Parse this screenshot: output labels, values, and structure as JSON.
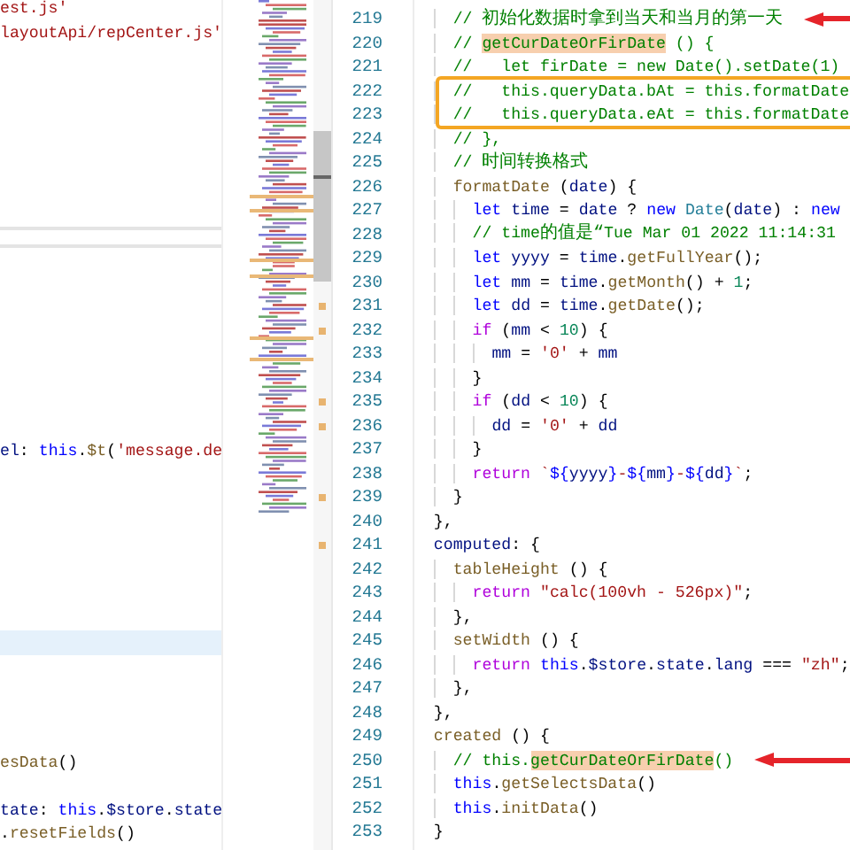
{
  "left_editor": {
    "top_lines": [
      {
        "text": "est.js'"
      },
      {
        "text": "layoutApi/repCenter.js'"
      }
    ],
    "bottom_lines": [
      {
        "text": "el: this.$t('message.de"
      },
      {
        "text": "esData()"
      },
      {
        "text": "tate: this.$store.state"
      },
      {
        "text": ".resetFields()"
      }
    ]
  },
  "editor": {
    "lines": [
      {
        "number": "219",
        "text": "    // 初始化数据时拿到当天和当月的第一天",
        "arrow": true,
        "boxed": false,
        "modified": false
      },
      {
        "number": "220",
        "segments": [
          {
            "text": "    // ",
            "highlighted": false
          },
          {
            "text": "getCurDateOrFirDate",
            "highlighted": true
          },
          {
            "text": " () {",
            "highlighted": false
          }
        ],
        "arrow": false,
        "boxed": false,
        "modified": false
      },
      {
        "number": "221",
        "text": "    //   let firDate = new Date().setDate(1)",
        "arrow": false,
        "boxed": false,
        "modified": false
      },
      {
        "number": "222",
        "text": "    //   this.queryData.bAt = this.formatDate",
        "arrow": false,
        "boxed": true,
        "modified": false
      },
      {
        "number": "223",
        "text": "    //   this.queryData.eAt = this.formatDate",
        "arrow": false,
        "boxed": true,
        "modified": false
      },
      {
        "number": "224",
        "text": "    // },",
        "arrow": false,
        "boxed": false,
        "modified": false
      },
      {
        "number": "225",
        "text": "    // 时间转换格式",
        "arrow": false,
        "boxed": false,
        "modified": false
      },
      {
        "number": "226",
        "text": "    formatDate (date) {",
        "arrow": false,
        "boxed": false,
        "modified": false
      },
      {
        "number": "227",
        "text": "      let time = date ? new Date(date) : new",
        "arrow": false,
        "boxed": false,
        "modified": false
      },
      {
        "number": "228",
        "text": "      // time的值是“Tue Mar 01 2022 11:14:31",
        "arrow": false,
        "boxed": false,
        "modified": false
      },
      {
        "number": "229",
        "text": "      let yyyy = time.getFullYear();",
        "arrow": false,
        "boxed": false,
        "modified": false
      },
      {
        "number": "230",
        "text": "      let mm = time.getMonth() + 1;",
        "arrow": false,
        "boxed": false,
        "modified": false
      },
      {
        "number": "231",
        "text": "      let dd = time.getDate();",
        "arrow": false,
        "boxed": false,
        "modified": true
      },
      {
        "number": "232",
        "text": "      if (mm < 10) {",
        "arrow": false,
        "boxed": false,
        "modified": true
      },
      {
        "number": "233",
        "text": "        mm = '0' + mm",
        "arrow": false,
        "boxed": false,
        "modified": false
      },
      {
        "number": "234",
        "text": "      }",
        "arrow": false,
        "boxed": false,
        "modified": false
      },
      {
        "number": "235",
        "text": "      if (dd < 10) {",
        "arrow": false,
        "boxed": false,
        "modified": true
      },
      {
        "number": "236",
        "text": "        dd = '0' + dd",
        "arrow": false,
        "boxed": false,
        "modified": true
      },
      {
        "number": "237",
        "text": "      }",
        "arrow": false,
        "boxed": false,
        "modified": false
      },
      {
        "number": "238",
        "text": "      return `${yyyy}-${mm}-${dd}`;",
        "arrow": false,
        "boxed": false,
        "modified": false
      },
      {
        "number": "239",
        "text": "    }",
        "arrow": false,
        "boxed": false,
        "modified": true
      },
      {
        "number": "240",
        "text": "  },",
        "arrow": false,
        "boxed": false,
        "modified": false
      },
      {
        "number": "241",
        "text": "  computed: {",
        "arrow": false,
        "boxed": false,
        "modified": true
      },
      {
        "number": "242",
        "text": "    tableHeight () {",
        "arrow": false,
        "boxed": false,
        "modified": false
      },
      {
        "number": "243",
        "text": "      return \"calc(100vh - 526px)\";",
        "arrow": false,
        "boxed": false,
        "modified": false
      },
      {
        "number": "244",
        "text": "    },",
        "arrow": false,
        "boxed": false,
        "modified": false
      },
      {
        "number": "245",
        "text": "    setWidth () {",
        "arrow": false,
        "boxed": false,
        "modified": false
      },
      {
        "number": "246",
        "text": "      return this.$store.state.lang === \"zh\";",
        "arrow": false,
        "boxed": false,
        "modified": false
      },
      {
        "number": "247",
        "text": "    },",
        "arrow": false,
        "boxed": false,
        "modified": false
      },
      {
        "number": "248",
        "text": "  },",
        "arrow": false,
        "boxed": false,
        "modified": false
      },
      {
        "number": "249",
        "text": "  created () {",
        "arrow": false,
        "boxed": false,
        "modified": false
      },
      {
        "number": "250",
        "segments": [
          {
            "text": "    // this.",
            "highlighted": false
          },
          {
            "text": "getCurDateOrFirDate",
            "highlighted": true
          },
          {
            "text": "()",
            "highlighted": false
          }
        ],
        "arrow": true,
        "boxed": false,
        "modified": false
      },
      {
        "number": "251",
        "text": "    this.getSelectsData()",
        "arrow": false,
        "boxed": false,
        "modified": false
      },
      {
        "number": "252",
        "text": "    this.initData()",
        "arrow": false,
        "boxed": false,
        "modified": false
      },
      {
        "number": "253",
        "text": "  }",
        "arrow": false,
        "boxed": false,
        "modified": false
      }
    ]
  }
}
